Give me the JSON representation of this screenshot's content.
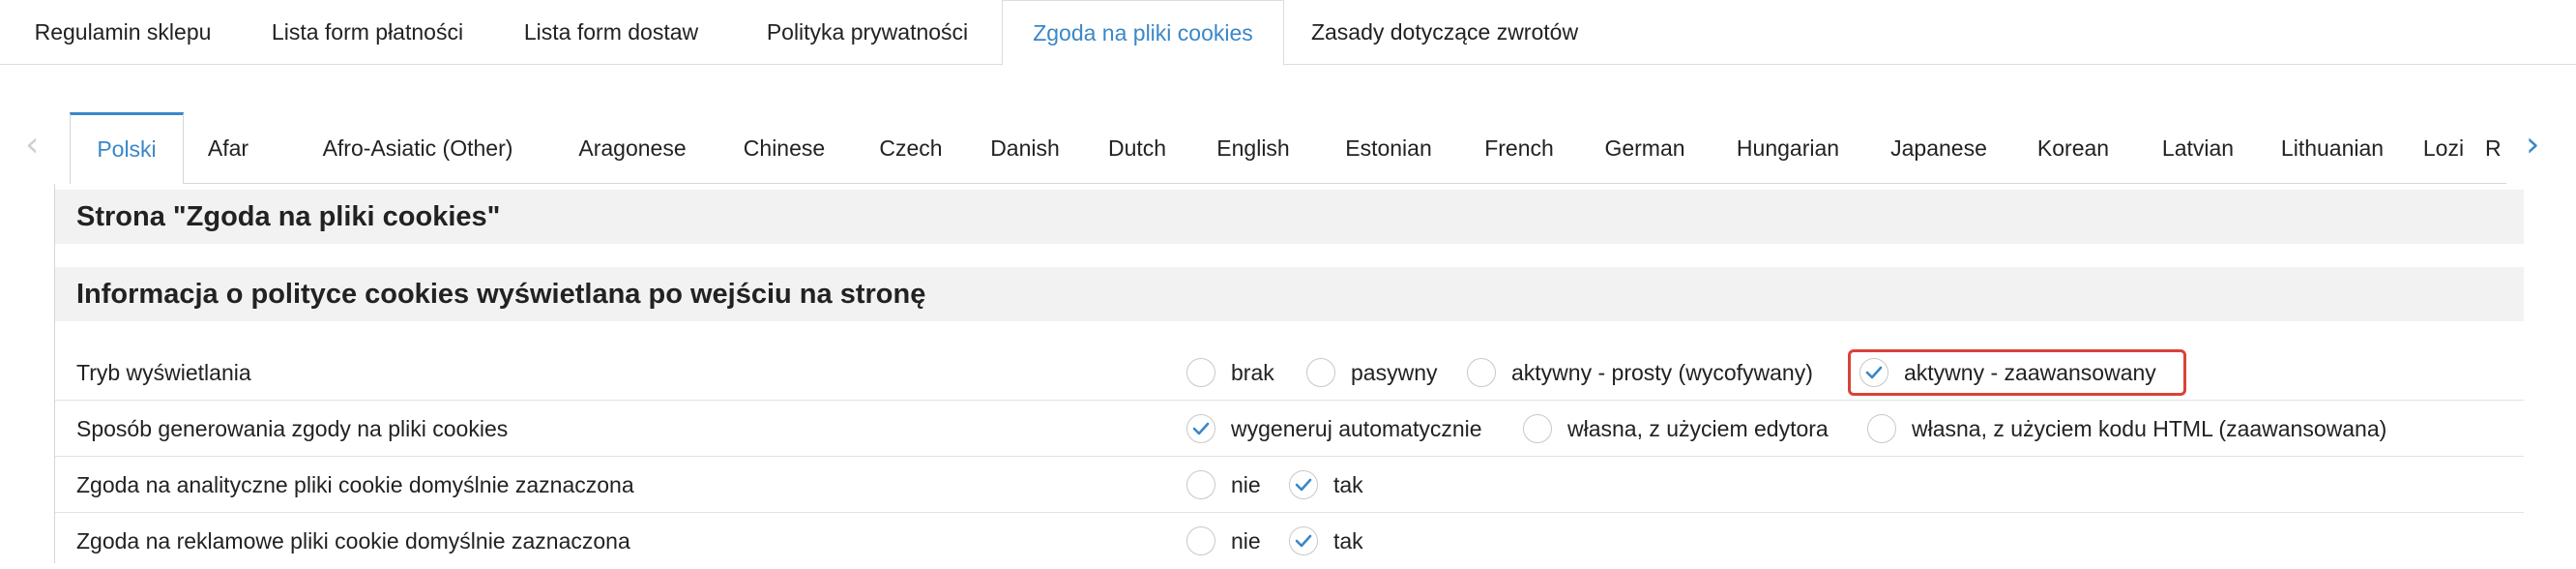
{
  "top_tabs": [
    {
      "label": "Regulamin sklepu",
      "active": false
    },
    {
      "label": "Lista form płatności",
      "active": false
    },
    {
      "label": "Lista form dostaw",
      "active": false
    },
    {
      "label": "Polityka prywatności",
      "active": false
    },
    {
      "label": "Zgoda na pliki cookies",
      "active": true
    },
    {
      "label": "Zasady dotyczące zwrotów",
      "active": false
    }
  ],
  "language_tabs": [
    {
      "label": "Polski",
      "active": true
    },
    {
      "label": "Afar"
    },
    {
      "label": "Afro-Asiatic (Other)"
    },
    {
      "label": "Aragonese"
    },
    {
      "label": "Chinese"
    },
    {
      "label": "Czech"
    },
    {
      "label": "Danish"
    },
    {
      "label": "Dutch"
    },
    {
      "label": "English"
    },
    {
      "label": "Estonian"
    },
    {
      "label": "French"
    },
    {
      "label": "German"
    },
    {
      "label": "Hungarian"
    },
    {
      "label": "Japanese"
    },
    {
      "label": "Korean"
    },
    {
      "label": "Latvian"
    },
    {
      "label": "Lithuanian"
    },
    {
      "label": "Lozi"
    },
    {
      "label": "R"
    }
  ],
  "page_header": "Strona \"Zgoda na pliki cookies\"",
  "section_header": "Informacja o polityce cookies wyświetlana po wejściu na stronę",
  "rows": [
    {
      "label": "Tryb wyświetlania",
      "options": [
        {
          "label": "brak",
          "checked": false
        },
        {
          "label": "pasywny",
          "checked": false
        },
        {
          "label": "aktywny - prosty (wycofywany)",
          "checked": false
        },
        {
          "label": "aktywny - zaawansowany",
          "checked": true,
          "highlighted": true
        }
      ]
    },
    {
      "label": "Sposób generowania zgody na pliki cookies",
      "options": [
        {
          "label": "wygeneruj automatycznie",
          "checked": true
        },
        {
          "label": "własna, z użyciem edytora",
          "checked": false
        },
        {
          "label": "własna, z użyciem kodu HTML (zaawansowana)",
          "checked": false
        }
      ]
    },
    {
      "label": "Zgoda na analityczne pliki cookie domyślnie zaznaczona",
      "options": [
        {
          "label": "nie",
          "checked": false
        },
        {
          "label": "tak",
          "checked": true
        }
      ]
    },
    {
      "label": "Zgoda na reklamowe pliki cookie domyślnie zaznaczona",
      "options": [
        {
          "label": "nie",
          "checked": false
        },
        {
          "label": "tak",
          "checked": true
        }
      ]
    }
  ],
  "colors": {
    "accent": "#3a87c8",
    "highlight_border": "#d9423a",
    "section_bg": "#f2f2f2"
  },
  "icons": {
    "prev": "chevron-left-icon",
    "next": "chevron-right-icon",
    "check": "checkmark-icon"
  }
}
